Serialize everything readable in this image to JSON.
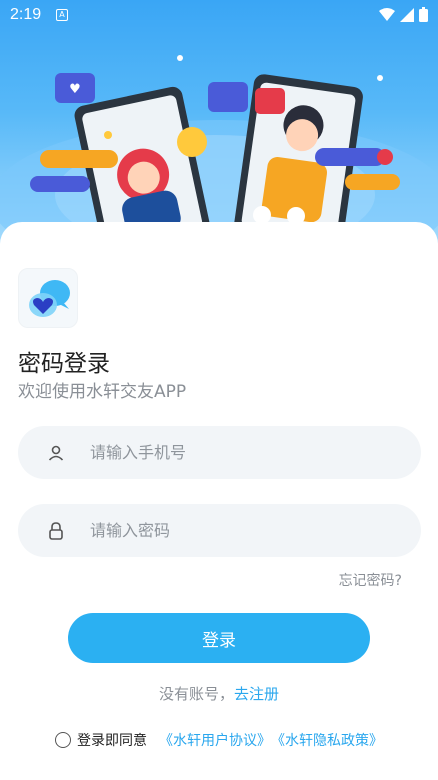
{
  "status_bar": {
    "time": "2:19",
    "app_icon_letter": "A"
  },
  "header": {},
  "login": {
    "title": "密码登录",
    "subtitle": "欢迎使用水轩交友APP",
    "phone_placeholder": "请输入手机号",
    "password_placeholder": "请输入密码",
    "forgot_password": "忘记密码?",
    "login_button": "登录",
    "no_account_text": "没有账号，",
    "register_link": "去注册",
    "agree_text": "登录即同意",
    "user_agreement": "《水轩用户协议》",
    "privacy_policy": "《水轩隐私政策》"
  },
  "colors": {
    "accent": "#2bb0f2",
    "link": "#2aa7ee",
    "hero_top": "#3aa6f5"
  },
  "icons": [
    "wifi-icon",
    "signal-icon",
    "battery-icon",
    "user-icon",
    "lock-icon",
    "app-logo-heart-icon"
  ]
}
